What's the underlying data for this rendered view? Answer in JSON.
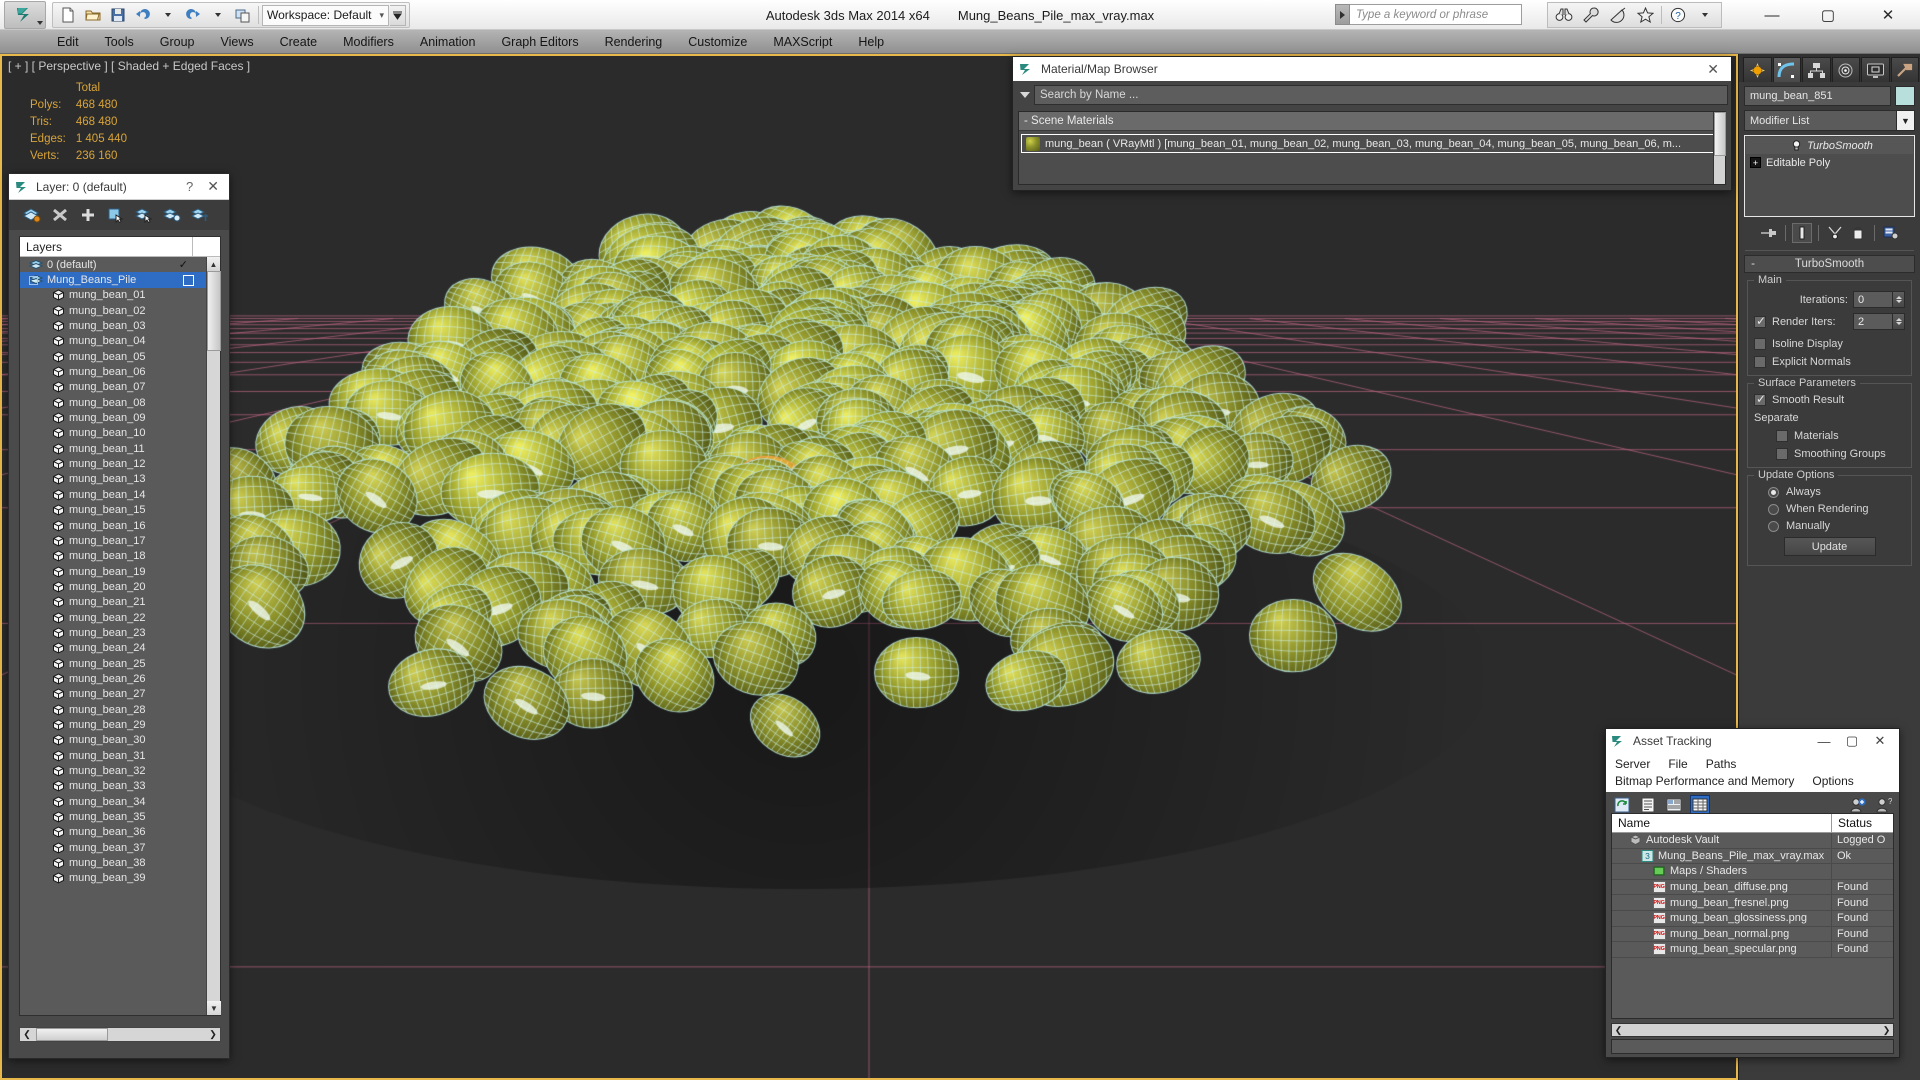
{
  "app": {
    "title_product": "Autodesk 3ds Max  2014 x64",
    "title_file": "Mung_Beans_Pile_max_vray.max",
    "workspace": "Workspace: Default",
    "search_placeholder": "Type a keyword or phrase",
    "window_controls": {
      "minimize": "—",
      "maximize": "▢",
      "close": "✕"
    },
    "quick_access_icons": [
      "new-file-icon",
      "open-file-icon",
      "save-file-icon",
      "undo-icon",
      "redo-icon",
      "project-folder-icon"
    ],
    "help_icons": [
      "binoculars-icon",
      "wrench-icon",
      "satellite-dish-icon",
      "star-icon",
      "help-question-icon"
    ]
  },
  "menu": {
    "items": [
      "Edit",
      "Tools",
      "Group",
      "Views",
      "Create",
      "Modifiers",
      "Animation",
      "Graph Editors",
      "Rendering",
      "Customize",
      "MAXScript",
      "Help"
    ]
  },
  "viewport": {
    "label": "[ + ] [ Perspective ] [ Shaded + Edged Faces ]",
    "stats_header": "Total",
    "stats": [
      {
        "label": "Polys:",
        "value": "468 480"
      },
      {
        "label": "Tris:",
        "value": "468 480"
      },
      {
        "label": "Edges:",
        "value": "1 405 440"
      },
      {
        "label": "Verts:",
        "value": "236 160"
      }
    ]
  },
  "layer_dialog": {
    "title": "Layer: 0 (default)",
    "help_glyph": "?",
    "close_glyph": "✕",
    "toolbar_icons": [
      "new-layer-icon",
      "delete-layer-icon",
      "add-layer-icon",
      "select-objects-icon",
      "select-highlight-icon",
      "layer-properties-icon",
      "layer-settings-icon"
    ],
    "column_header": "Layers",
    "rows": [
      {
        "name": "0 (default)",
        "indent": 0,
        "selected": false,
        "check": true
      },
      {
        "name": "Mung_Beans_Pile",
        "indent": 0,
        "selected": true,
        "expander": true,
        "box": true
      },
      {
        "name": "mung_bean_01",
        "indent": 1
      },
      {
        "name": "mung_bean_02",
        "indent": 1
      },
      {
        "name": "mung_bean_03",
        "indent": 1
      },
      {
        "name": "mung_bean_04",
        "indent": 1
      },
      {
        "name": "mung_bean_05",
        "indent": 1
      },
      {
        "name": "mung_bean_06",
        "indent": 1
      },
      {
        "name": "mung_bean_07",
        "indent": 1
      },
      {
        "name": "mung_bean_08",
        "indent": 1
      },
      {
        "name": "mung_bean_09",
        "indent": 1
      },
      {
        "name": "mung_bean_10",
        "indent": 1
      },
      {
        "name": "mung_bean_11",
        "indent": 1
      },
      {
        "name": "mung_bean_12",
        "indent": 1
      },
      {
        "name": "mung_bean_13",
        "indent": 1
      },
      {
        "name": "mung_bean_14",
        "indent": 1
      },
      {
        "name": "mung_bean_15",
        "indent": 1
      },
      {
        "name": "mung_bean_16",
        "indent": 1
      },
      {
        "name": "mung_bean_17",
        "indent": 1
      },
      {
        "name": "mung_bean_18",
        "indent": 1
      },
      {
        "name": "mung_bean_19",
        "indent": 1
      },
      {
        "name": "mung_bean_20",
        "indent": 1
      },
      {
        "name": "mung_bean_21",
        "indent": 1
      },
      {
        "name": "mung_bean_22",
        "indent": 1
      },
      {
        "name": "mung_bean_23",
        "indent": 1
      },
      {
        "name": "mung_bean_24",
        "indent": 1
      },
      {
        "name": "mung_bean_25",
        "indent": 1
      },
      {
        "name": "mung_bean_26",
        "indent": 1
      },
      {
        "name": "mung_bean_27",
        "indent": 1
      },
      {
        "name": "mung_bean_28",
        "indent": 1
      },
      {
        "name": "mung_bean_29",
        "indent": 1
      },
      {
        "name": "mung_bean_30",
        "indent": 1
      },
      {
        "name": "mung_bean_31",
        "indent": 1
      },
      {
        "name": "mung_bean_32",
        "indent": 1
      },
      {
        "name": "mung_bean_33",
        "indent": 1
      },
      {
        "name": "mung_bean_34",
        "indent": 1
      },
      {
        "name": "mung_bean_35",
        "indent": 1
      },
      {
        "name": "mung_bean_36",
        "indent": 1
      },
      {
        "name": "mung_bean_37",
        "indent": 1
      },
      {
        "name": "mung_bean_38",
        "indent": 1
      },
      {
        "name": "mung_bean_39",
        "indent": 1
      }
    ]
  },
  "material_browser": {
    "title": "Material/Map Browser",
    "close_glyph": "✕",
    "search_placeholder": "Search by Name ...",
    "section": "- Scene Materials",
    "material": "mung_bean  ( VRayMtl )  [mung_bean_01, mung_bean_02, mung_bean_03, mung_bean_04, mung_bean_05, mung_bean_06, m..."
  },
  "command_panel": {
    "tabs": [
      "create-tab-icon",
      "modify-tab-icon",
      "hierarchy-tab-icon",
      "motion-tab-icon",
      "display-tab-icon",
      "utilities-tab-icon"
    ],
    "active_tab_index": 1,
    "object_name": "mung_bean_851",
    "object_color": "#b9dfdc",
    "modifier_list_label": "Modifier List",
    "stack": [
      {
        "name": "TurboSmooth",
        "type": "modifier"
      },
      {
        "name": "Editable Poly",
        "type": "base"
      }
    ],
    "stack_tools": [
      "pin-stack-icon",
      "show-end-result-icon",
      "make-unique-icon",
      "remove-modifier-icon",
      "configure-sets-icon"
    ],
    "rollup": {
      "title": "TurboSmooth",
      "collapse_glyph": "-",
      "groups": [
        {
          "title": "Main",
          "fields": [
            {
              "kind": "spinner",
              "label": "Iterations:",
              "value": "0"
            },
            {
              "kind": "check_spinner",
              "label": "Render Iters:",
              "value": "2",
              "checked": true
            },
            {
              "kind": "checkbox",
              "label": "Isoline Display",
              "checked": false
            },
            {
              "kind": "checkbox",
              "label": "Explicit Normals",
              "checked": false
            }
          ]
        },
        {
          "title": "Surface Parameters",
          "fields": [
            {
              "kind": "checkbox",
              "label": "Smooth Result",
              "checked": true
            },
            {
              "kind": "text",
              "label": "Separate"
            },
            {
              "kind": "checkbox",
              "label": "Materials",
              "checked": false,
              "indent": true
            },
            {
              "kind": "checkbox",
              "label": "Smoothing Groups",
              "checked": false,
              "indent": true
            }
          ]
        },
        {
          "title": "Update Options",
          "fields": [
            {
              "kind": "radio",
              "label": "Always",
              "checked": true
            },
            {
              "kind": "radio",
              "label": "When Rendering",
              "checked": false
            },
            {
              "kind": "radio",
              "label": "Manually",
              "checked": false
            },
            {
              "kind": "button",
              "label": "Update"
            }
          ]
        }
      ]
    }
  },
  "asset_tracking": {
    "title": "Asset Tracking",
    "window_controls": {
      "minimize": "—",
      "maximize": "▢",
      "close": "✕"
    },
    "menu_row_1": [
      "Server",
      "File",
      "Paths"
    ],
    "menu_row_2": [
      "Bitmap Performance and Memory",
      "Options"
    ],
    "toolbar_icons": [
      "refresh-icon",
      "list-view-icon",
      "detail-view-icon",
      "grid-view-icon",
      "add-vault-icon",
      "vault-help-icon"
    ],
    "columns": [
      "Name",
      "Status"
    ],
    "rows": [
      {
        "name": "Autodesk Vault",
        "status": "Logged O",
        "level": 1,
        "icon": "vault-icon"
      },
      {
        "name": "Mung_Beans_Pile_max_vray.max",
        "status": "Ok",
        "level": 2,
        "icon": "max-file-icon"
      },
      {
        "name": "Maps / Shaders",
        "status": "",
        "level": 3,
        "icon": "maps-folder-icon"
      },
      {
        "name": "mung_bean_diffuse.png",
        "status": "Found",
        "level": 3,
        "icon": "png-icon"
      },
      {
        "name": "mung_bean_fresnel.png",
        "status": "Found",
        "level": 3,
        "icon": "png-icon"
      },
      {
        "name": "mung_bean_glossiness.png",
        "status": "Found",
        "level": 3,
        "icon": "png-icon"
      },
      {
        "name": "mung_bean_normal.png",
        "status": "Found",
        "level": 3,
        "icon": "png-icon"
      },
      {
        "name": "mung_bean_specular.png",
        "status": "Found",
        "level": 3,
        "icon": "png-icon"
      }
    ]
  },
  "colors": {
    "viewport_bg": "#2b2b2b",
    "viewport_border": "#e8b84b",
    "stats_text": "#d8a43a",
    "grid_pink": "#c86a8e",
    "selection_blue": "#2f6cc4",
    "bean_light": "#c9cc4e",
    "bean_dark": "#6f7a1e",
    "wireframe": "#cfeee8"
  }
}
